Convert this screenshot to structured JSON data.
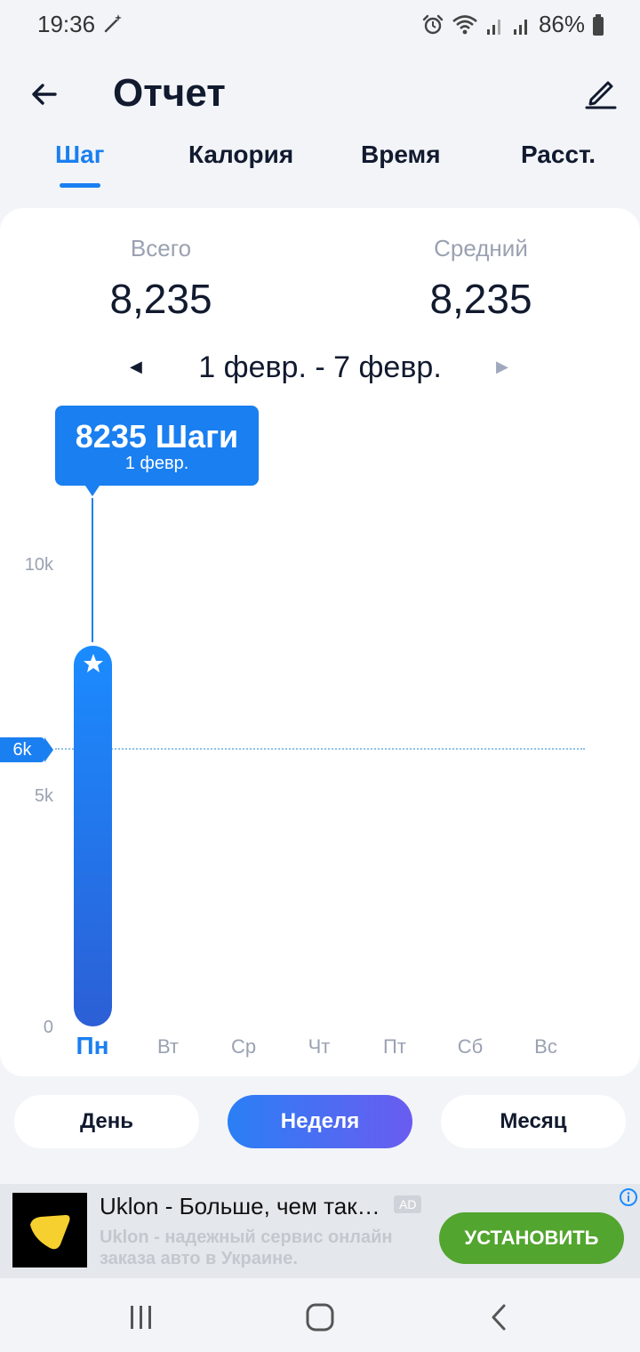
{
  "status_bar": {
    "time": "19:36",
    "battery_percent": "86%",
    "icons": [
      "magic-wand-icon",
      "alarm-icon",
      "wifi-icon",
      "signal-icon",
      "signal-icon",
      "battery-icon"
    ]
  },
  "header": {
    "title": "Отчет",
    "back_icon": "arrow-left-icon",
    "edit_icon": "pencil-icon"
  },
  "tabs": [
    {
      "label": "Шаг",
      "active": true
    },
    {
      "label": "Калория",
      "active": false
    },
    {
      "label": "Время",
      "active": false
    },
    {
      "label": "Расст.",
      "active": false
    }
  ],
  "summary": {
    "total_label": "Всего",
    "total_value": "8,235",
    "average_label": "Средний",
    "average_value": "8,235"
  },
  "date_range": {
    "text": "1 февр. - 7 февр.",
    "prev": "◀",
    "next": "▶"
  },
  "tooltip": {
    "value": "8235 Шаги",
    "date": "1 февр."
  },
  "goal": {
    "label": "6k",
    "value": 6000
  },
  "chart_data": {
    "type": "bar",
    "categories": [
      "Пн",
      "Вт",
      "Ср",
      "Чт",
      "Пт",
      "Сб",
      "Вс"
    ],
    "values": [
      8235,
      0,
      0,
      0,
      0,
      0,
      0
    ],
    "y_ticks": [
      "10k",
      "5k",
      "0"
    ],
    "ylim": [
      0,
      10000
    ],
    "selected_category": "Пн",
    "colors": {
      "bar": "#1a7ff0",
      "goal_line": "#8cc1e8"
    }
  },
  "period_buttons": [
    {
      "label": "День",
      "active": false
    },
    {
      "label": "Неделя",
      "active": true
    },
    {
      "label": "Месяц",
      "active": false
    }
  ],
  "ad": {
    "title": "Uklon - Больше, чем так…",
    "badge": "AD",
    "description": "Uklon - надежный сервис онлайн заказа авто в Украине.",
    "install_label": "УСТАНОВИТЬ",
    "info_icon": "info-icon"
  },
  "navbar": {
    "icons": [
      "recent-apps-icon",
      "home-icon",
      "back-icon"
    ]
  },
  "colors": {
    "accent": "#1a7ff0",
    "install_button": "#52a52e"
  }
}
